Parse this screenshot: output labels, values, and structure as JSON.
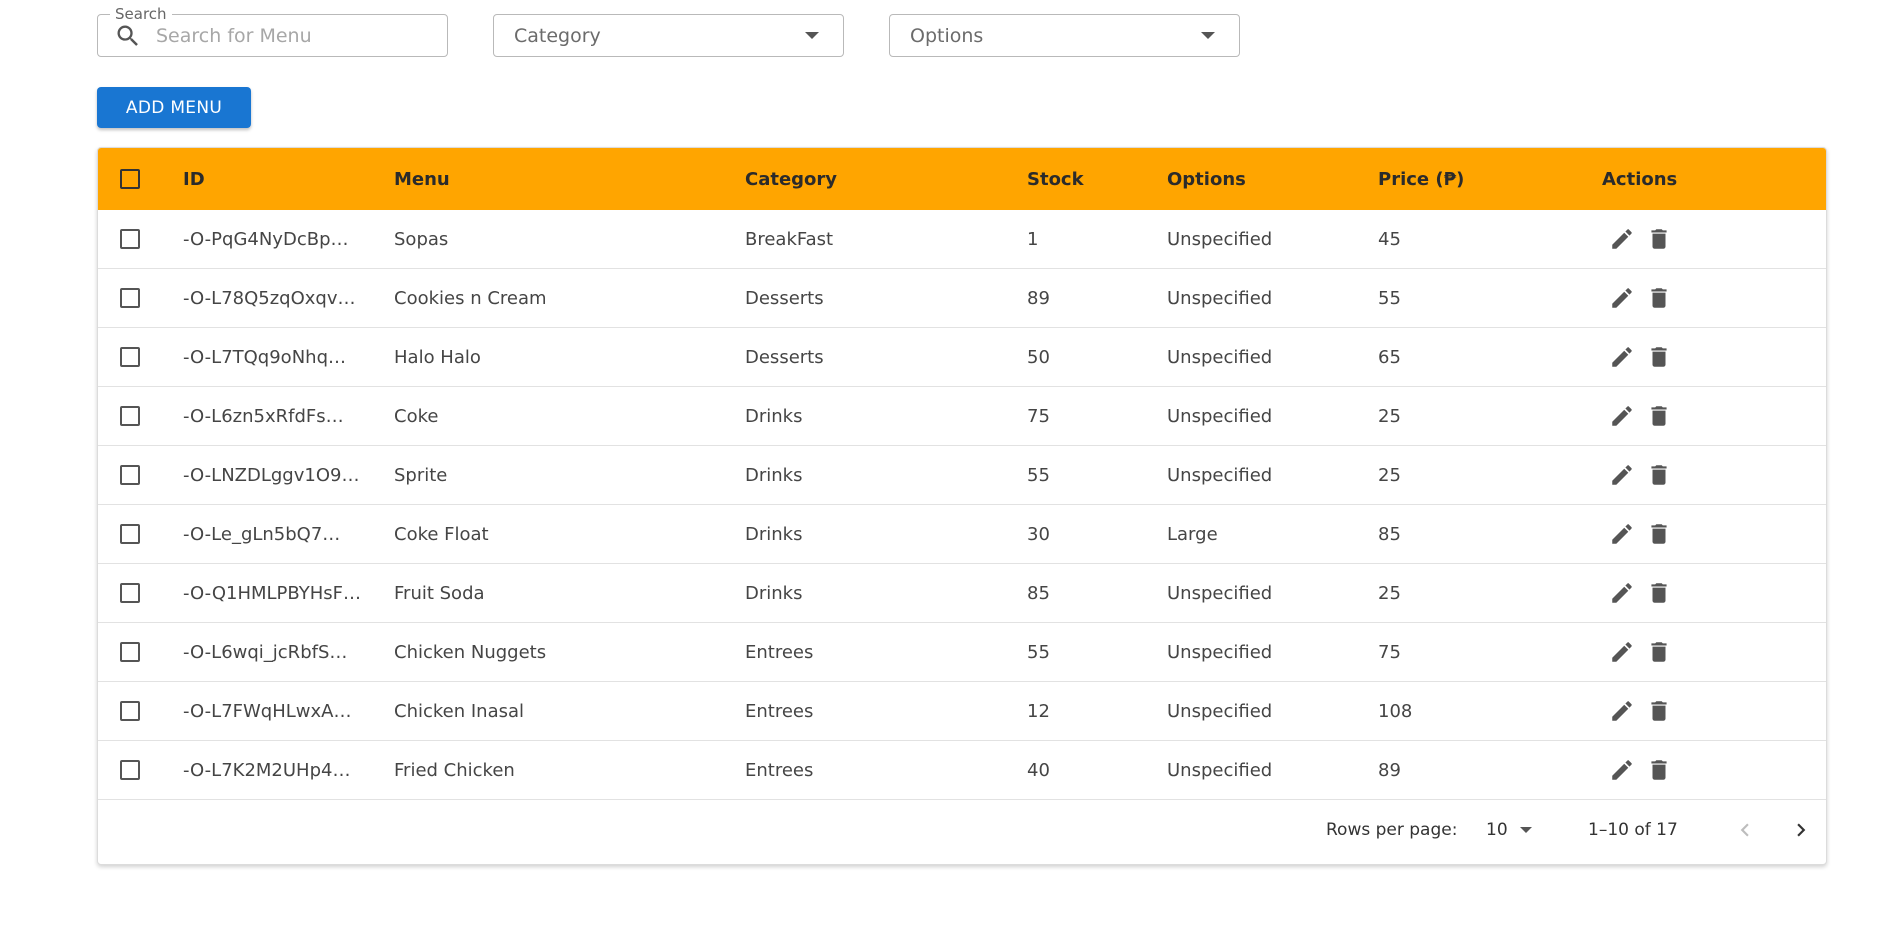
{
  "filters": {
    "search_legend": "Search",
    "search_placeholder": "Search for Menu",
    "category_value": "Category",
    "options_value": "Options"
  },
  "toolbar": {
    "add_label": "ADD MENU"
  },
  "table": {
    "header_color": "#ffa500",
    "columns": {
      "id": "ID",
      "menu": "Menu",
      "category": "Category",
      "stock": "Stock",
      "options": "Options",
      "price": "Price (₱)",
      "actions": "Actions"
    },
    "rows": [
      {
        "id": "-O-PqG4NyDcBp…",
        "menu": "Sopas",
        "category": "BreakFast",
        "stock": "1",
        "options": "Unspecified",
        "price": "45"
      },
      {
        "id": "-O-L78Q5zqOxqv…",
        "menu": "Cookies n Cream",
        "category": "Desserts",
        "stock": "89",
        "options": "Unspecified",
        "price": "55"
      },
      {
        "id": "-O-L7TQq9oNhq…",
        "menu": "Halo Halo",
        "category": "Desserts",
        "stock": "50",
        "options": "Unspecified",
        "price": "65"
      },
      {
        "id": "-O-L6zn5xRfdFs…",
        "menu": "Coke",
        "category": "Drinks",
        "stock": "75",
        "options": "Unspecified",
        "price": "25"
      },
      {
        "id": "-O-LNZDLggv1O9…",
        "menu": "Sprite",
        "category": "Drinks",
        "stock": "55",
        "options": "Unspecified",
        "price": "25"
      },
      {
        "id": "-O-Le_gLn5bQ7…",
        "menu": "Coke Float",
        "category": "Drinks",
        "stock": "30",
        "options": "Large",
        "price": "85"
      },
      {
        "id": "-O-Q1HMLPBYHsF…",
        "menu": "Fruit Soda",
        "category": "Drinks",
        "stock": "85",
        "options": "Unspecified",
        "price": "25"
      },
      {
        "id": "-O-L6wqi_jcRbfS…",
        "menu": "Chicken Nuggets",
        "category": "Entrees",
        "stock": "55",
        "options": "Unspecified",
        "price": "75"
      },
      {
        "id": "-O-L7FWqHLwxA…",
        "menu": "Chicken Inasal",
        "category": "Entrees",
        "stock": "12",
        "options": "Unspecified",
        "price": "108"
      },
      {
        "id": "-O-L7K2M2UHp4…",
        "menu": "Fried Chicken",
        "category": "Entrees",
        "stock": "40",
        "options": "Unspecified",
        "price": "89"
      }
    ],
    "row_icons": [
      "pencil-icon",
      "trash-icon"
    ]
  },
  "pagination": {
    "rows_per_page_label": "Rows per page:",
    "rows_per_page_value": "10",
    "range": "1–10 of 17",
    "prev_icon": "chevron-left-icon",
    "next_icon": "chevron-right-icon"
  },
  "colors": {
    "accent": "#1976d2",
    "header": "#ffa500"
  }
}
